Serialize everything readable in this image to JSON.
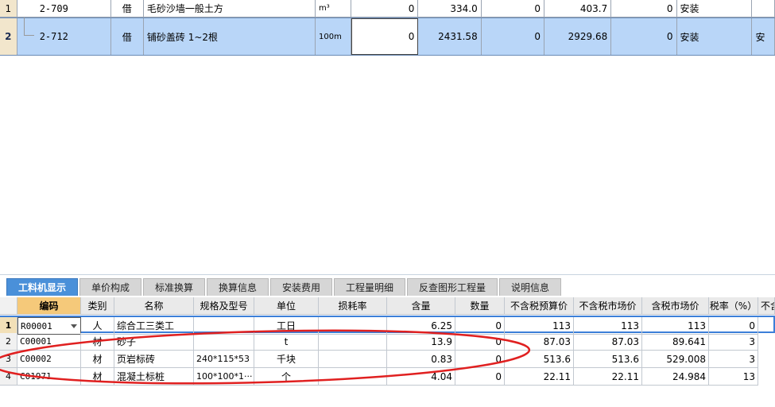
{
  "top_grid": {
    "rows": [
      {
        "num": "1",
        "code": "2-709",
        "type": "借",
        "name": "毛砂沙墙一般土方",
        "unit": "m³",
        "qty": "0",
        "price": "334.0",
        "v1": "0",
        "v2": "403.7",
        "v3": "0",
        "category": "安装",
        "extra": ""
      },
      {
        "num": "2",
        "code": "2-712",
        "type": "借",
        "name": "铺砂盖砖 1~2根",
        "unit": "100m",
        "qty": "0",
        "price": "2431.58",
        "v1": "0",
        "v2": "2929.68",
        "v3": "0",
        "category": "安装",
        "extra": "安"
      }
    ]
  },
  "tabs": [
    {
      "label": "工料机显示",
      "active": true
    },
    {
      "label": "单价构成",
      "active": false
    },
    {
      "label": "标准换算",
      "active": false
    },
    {
      "label": "换算信息",
      "active": false
    },
    {
      "label": "安装费用",
      "active": false
    },
    {
      "label": "工程量明细",
      "active": false
    },
    {
      "label": "反查图形工程量",
      "active": false
    },
    {
      "label": "说明信息",
      "active": false
    }
  ],
  "bottom_grid": {
    "headers": [
      "编码",
      "类别",
      "名称",
      "规格及型号",
      "单位",
      "损耗率",
      "含量",
      "数量",
      "不含税预算价",
      "不含税市场价",
      "含税市场价",
      "税率（%）",
      "不含"
    ],
    "rows": [
      {
        "num": "1",
        "code": "R00001",
        "type": "人",
        "name": "综合工三类工",
        "spec": "",
        "unit": "工日",
        "loss": "",
        "content": "6.25",
        "qty": "0",
        "budget": "113",
        "market": "113",
        "tax_market": "113",
        "tax_rate": "0"
      },
      {
        "num": "2",
        "code": "C00001",
        "type": "材",
        "name": "砂子",
        "spec": "",
        "unit": "t",
        "loss": "",
        "content": "13.9",
        "qty": "0",
        "budget": "87.03",
        "market": "87.03",
        "tax_market": "89.641",
        "tax_rate": "3"
      },
      {
        "num": "3",
        "code": "C00002",
        "type": "材",
        "name": "页岩标砖",
        "spec": "240*115*53",
        "unit": "千块",
        "loss": "",
        "content": "0.83",
        "qty": "0",
        "budget": "513.6",
        "market": "513.6",
        "tax_market": "529.008",
        "tax_rate": "3"
      },
      {
        "num": "4",
        "code": "C01971",
        "type": "材",
        "name": "混凝土标桩",
        "spec": "100*100*1···",
        "unit": "个",
        "loss": "",
        "content": "4.04",
        "qty": "0",
        "budget": "22.11",
        "market": "22.11",
        "tax_market": "24.984",
        "tax_rate": "13"
      }
    ]
  },
  "colors": {
    "selected_row": "#b9d6f8",
    "active_tab": "#4a90d9",
    "annotation": "#e02020",
    "header_code": "#f5c97a"
  }
}
